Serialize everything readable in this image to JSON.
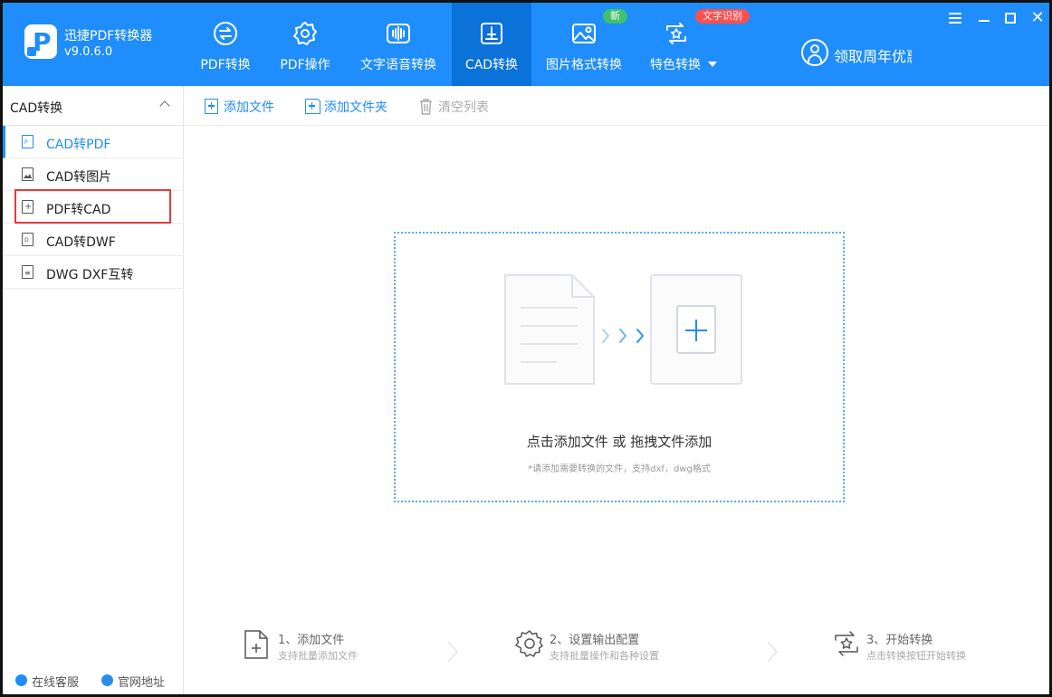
{
  "app": {
    "name": "迅捷PDF转换器",
    "version": "v9.0.6.0",
    "brand_color": "#1f8dfc",
    "logo_letter": "P",
    "promo": "领取周年优惠"
  },
  "nav": {
    "tabs": [
      {
        "label": "PDF转换",
        "icon": "pdf-convert-icon"
      },
      {
        "label": "PDF操作",
        "icon": "gear-doc-icon"
      },
      {
        "label": "文字语音转换",
        "icon": "audio-wave-icon"
      },
      {
        "label": "CAD转换",
        "icon": "cad-icon",
        "active": true
      },
      {
        "label": "图片格式转换",
        "icon": "image-icon",
        "badge": "新"
      },
      {
        "label": "特色转换",
        "icon": "star-convert-icon",
        "badge": "文字识别"
      }
    ]
  },
  "window": {
    "controls": [
      "menu-icon",
      "minimize-icon",
      "maximize-icon",
      "close-icon"
    ],
    "close_glyph": "✕"
  },
  "sidebar": {
    "title": "CAD转换",
    "items": [
      {
        "label": "CAD转PDF",
        "icon_tag": "P",
        "active": true
      },
      {
        "label": "CAD转图片",
        "icon_tag": ""
      },
      {
        "label": "PDF转CAD",
        "icon_tag": "+",
        "highlighted": true
      },
      {
        "label": "CAD转DWF",
        "icon_tag": "D"
      },
      {
        "label": "DWG DXF互转",
        "icon_tag": "≡"
      }
    ],
    "footer": {
      "service": "在线客服",
      "website": "官网地址"
    }
  },
  "toolbar": {
    "add_file": "添加文件",
    "add_folder": "添加文件夹",
    "clear_list": "清空列表"
  },
  "dropzone": {
    "title": "点击添加文件 或 拖拽文件添加",
    "hint": "*请添加需要转换的文件，支持dxf，dwg格式",
    "arrows": "› › ›"
  },
  "steps": [
    {
      "title": "1、添加文件",
      "sub": "支持批量添加文件"
    },
    {
      "title": "2、设置输出配置",
      "sub": "支持批量操作和各种设置"
    },
    {
      "title": "3、开始转换",
      "sub": "点击转换按钮开始转换"
    }
  ]
}
